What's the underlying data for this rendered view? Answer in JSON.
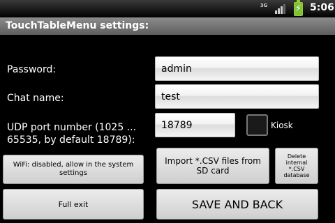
{
  "status_bar": {
    "network": "3G",
    "time": "5:06"
  },
  "title": "TouchTableMenu settings:",
  "password": {
    "label": "Password:",
    "value": "admin"
  },
  "chat_name": {
    "label": "Chat name:",
    "value": "test"
  },
  "udp_port": {
    "label": "UDP port number (1025 ... 65535, by default 18789):",
    "value": "18789"
  },
  "kiosk": {
    "label": "Kiosk",
    "checked": false
  },
  "buttons": {
    "wifi": "WiFi: disabled, allow in the system settings",
    "import_csv": "Import *.CSV files from SD card",
    "delete_db": "Delete internal *.CSV database",
    "full_exit": "Full exit",
    "save_back": "SAVE AND BACK"
  }
}
